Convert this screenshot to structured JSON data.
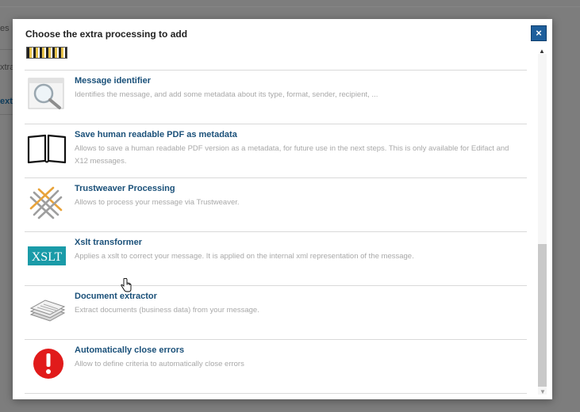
{
  "background": {
    "fragment_1": "es",
    "fragment_2": "xtra",
    "fragment_3": "ext"
  },
  "modal": {
    "title": "Choose the extra processing to add",
    "close_label": "×",
    "logo_text": "2Bist"
  },
  "items": [
    {
      "icon": "magnifier-icon",
      "title": "Message identifier",
      "description": "Identifies the message, and add some metadata about its type, format, sender, recipient, ..."
    },
    {
      "icon": "open-book-icon",
      "title": "Save human readable PDF as metadata",
      "description": "Allows to save a human readable PDF version as a metadata, for future use in the next steps. This is only available for Edifact and X12 messages."
    },
    {
      "icon": "trustweaver-icon",
      "title": "Trustweaver Processing",
      "description": "Allows to process your message via Trustweaver."
    },
    {
      "icon": "xslt-icon",
      "icon_text": "XSLT",
      "title": "Xslt transformer",
      "description": "Applies a xslt to correct your message. It is applied on the internal xml representation of the message."
    },
    {
      "icon": "documents-stack-icon",
      "title": "Document extractor",
      "description": "Extract documents (business data) from your message."
    },
    {
      "icon": "error-alert-icon",
      "title": "Automatically close errors",
      "description": "Allow to define criteria to automatically close errors"
    }
  ],
  "colors": {
    "title_blue": "#1a5079",
    "close_blue": "#1e5f9c",
    "xslt_teal": "#1a9ba8",
    "error_red": "#e11b1b",
    "trust_orange": "#e8a33a"
  }
}
